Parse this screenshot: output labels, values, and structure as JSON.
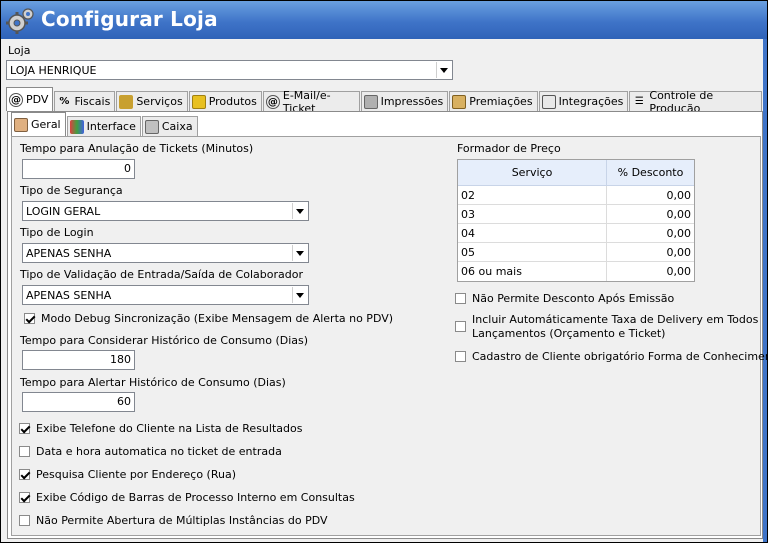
{
  "window": {
    "title": "Configurar Loja"
  },
  "store": {
    "label": "Loja",
    "value": "LOJA HENRIQUE"
  },
  "main_tabs": [
    {
      "label": "PDV",
      "icon": "at-icon"
    },
    {
      "label": "Fiscais",
      "icon": "percent-icon"
    },
    {
      "label": "Serviços",
      "icon": "service-icon"
    },
    {
      "label": "Produtos",
      "icon": "box-icon"
    },
    {
      "label": "E-Mail/e-Ticket",
      "icon": "at-icon"
    },
    {
      "label": "Impressões",
      "icon": "printer-icon"
    },
    {
      "label": "Premiações",
      "icon": "award-icon"
    },
    {
      "label": "Integrações",
      "icon": "integration-icon"
    },
    {
      "label": "Controle de Produção",
      "icon": "list-icon"
    }
  ],
  "sub_tabs": [
    {
      "label": "Geral",
      "icon": "hand-icon"
    },
    {
      "label": "Interface",
      "icon": "interface-icon"
    },
    {
      "label": "Caixa",
      "icon": "register-icon"
    }
  ],
  "fields": {
    "ticket_cancel_label": "Tempo para Anulação de Tickets (Minutos)",
    "ticket_cancel_value": "0",
    "security_label": "Tipo de Segurança",
    "security_value": "LOGIN GERAL",
    "login_label": "Tipo de Login",
    "login_value": "APENAS SENHA",
    "validation_label": "Tipo de Validação de Entrada/Saída de Colaborador",
    "validation_value": "APENAS SENHA",
    "debug_label": "Modo Debug Sincronização (Exibe Mensagem de Alerta no PDV)",
    "history_consider_label": "Tempo para Considerar Histórico de Consumo (Dias)",
    "history_consider_value": "180",
    "history_alert_label": "Tempo para Alertar Histórico de Consumo (Dias)",
    "history_alert_value": "60"
  },
  "checks": [
    {
      "label": "Exibe Telefone do Cliente na Lista de Resultados",
      "checked": true
    },
    {
      "label": "Data e hora automatica no ticket de  entrada",
      "checked": false
    },
    {
      "label": "Pesquisa Cliente por Endereço (Rua)",
      "checked": true
    },
    {
      "label": "Exibe Código de Barras de Processo Interno em Consultas",
      "checked": true
    },
    {
      "label": "Não Permite Abertura de Múltiplas Instâncias do PDV",
      "checked": false
    }
  ],
  "price_former": {
    "label": "Formador de Preço",
    "columns": [
      "Serviço",
      "% Desconto"
    ],
    "rows": [
      [
        "02",
        "0,00"
      ],
      [
        "03",
        "0,00"
      ],
      [
        "04",
        "0,00"
      ],
      [
        "05",
        "0,00"
      ],
      [
        "06 ou mais",
        "0,00"
      ]
    ]
  },
  "right_checks": [
    {
      "label": "Não Permite Desconto Após Emissão",
      "checked": false
    },
    {
      "label": "Incluir Automáticamente Taxa de Delivery em Todos",
      "label2": "Lançamentos (Orçamento e Ticket)",
      "checked": false
    },
    {
      "label": "Cadastro de Cliente obrigatório Forma de Conhecimento",
      "checked": false
    }
  ],
  "colors": {
    "title_bar": "#3f74c8",
    "title_text": "#ffffff"
  }
}
